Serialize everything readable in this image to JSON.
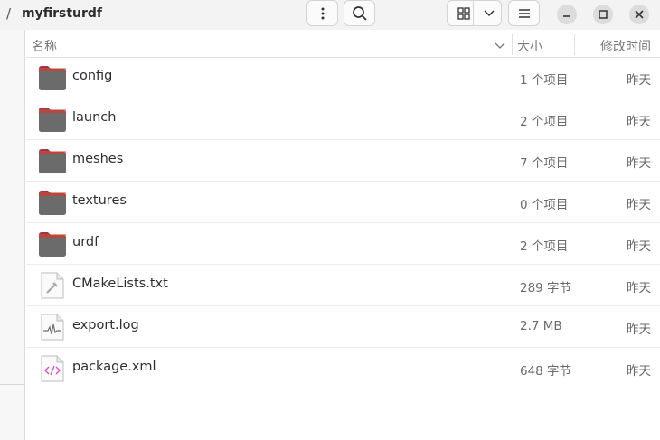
{
  "header": {
    "path_separator": "/",
    "folder_name": "myfirsturdf"
  },
  "columns": {
    "name": "名称",
    "size": "大小",
    "modified": "修改时间"
  },
  "files": [
    {
      "name": "config",
      "size": "1 个项目",
      "modified": "昨天",
      "icon": "folder-icon"
    },
    {
      "name": "launch",
      "size": "2 个项目",
      "modified": "昨天",
      "icon": "folder-icon"
    },
    {
      "name": "meshes",
      "size": "7 个项目",
      "modified": "昨天",
      "icon": "folder-icon"
    },
    {
      "name": "textures",
      "size": "0 个项目",
      "modified": "昨天",
      "icon": "folder-icon"
    },
    {
      "name": "urdf",
      "size": "2 个项目",
      "modified": "昨天",
      "icon": "folder-icon"
    },
    {
      "name": "CMakeLists.txt",
      "size": "289 字节",
      "modified": "昨天",
      "icon": "build-file-icon"
    },
    {
      "name": "export.log",
      "size": "2.7 MB",
      "modified": "昨天",
      "icon": "log-file-icon"
    },
    {
      "name": "package.xml",
      "size": "648 字节",
      "modified": "昨天",
      "icon": "xml-file-icon"
    }
  ],
  "colors": {
    "folder_body": "#6b6b6b",
    "folder_tab": "#a2334a",
    "xml_accent": "#d84fc8"
  }
}
